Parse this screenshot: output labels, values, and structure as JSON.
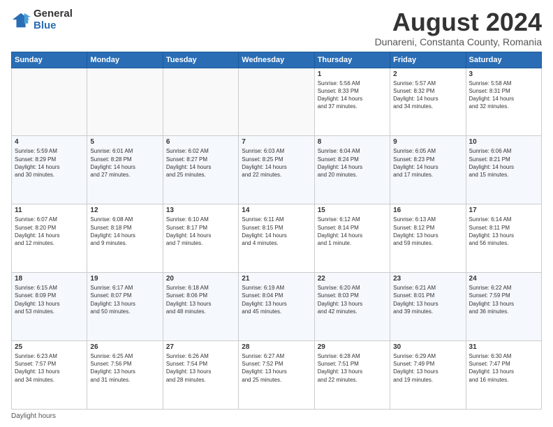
{
  "logo": {
    "general": "General",
    "blue": "Blue"
  },
  "title": "August 2024",
  "subtitle": "Dunareni, Constanta County, Romania",
  "days_header": [
    "Sunday",
    "Monday",
    "Tuesday",
    "Wednesday",
    "Thursday",
    "Friday",
    "Saturday"
  ],
  "footer": "Daylight hours",
  "weeks": [
    [
      {
        "day": "",
        "info": ""
      },
      {
        "day": "",
        "info": ""
      },
      {
        "day": "",
        "info": ""
      },
      {
        "day": "",
        "info": ""
      },
      {
        "day": "1",
        "info": "Sunrise: 5:56 AM\nSunset: 8:33 PM\nDaylight: 14 hours\nand 37 minutes."
      },
      {
        "day": "2",
        "info": "Sunrise: 5:57 AM\nSunset: 8:32 PM\nDaylight: 14 hours\nand 34 minutes."
      },
      {
        "day": "3",
        "info": "Sunrise: 5:58 AM\nSunset: 8:31 PM\nDaylight: 14 hours\nand 32 minutes."
      }
    ],
    [
      {
        "day": "4",
        "info": "Sunrise: 5:59 AM\nSunset: 8:29 PM\nDaylight: 14 hours\nand 30 minutes."
      },
      {
        "day": "5",
        "info": "Sunrise: 6:01 AM\nSunset: 8:28 PM\nDaylight: 14 hours\nand 27 minutes."
      },
      {
        "day": "6",
        "info": "Sunrise: 6:02 AM\nSunset: 8:27 PM\nDaylight: 14 hours\nand 25 minutes."
      },
      {
        "day": "7",
        "info": "Sunrise: 6:03 AM\nSunset: 8:25 PM\nDaylight: 14 hours\nand 22 minutes."
      },
      {
        "day": "8",
        "info": "Sunrise: 6:04 AM\nSunset: 8:24 PM\nDaylight: 14 hours\nand 20 minutes."
      },
      {
        "day": "9",
        "info": "Sunrise: 6:05 AM\nSunset: 8:23 PM\nDaylight: 14 hours\nand 17 minutes."
      },
      {
        "day": "10",
        "info": "Sunrise: 6:06 AM\nSunset: 8:21 PM\nDaylight: 14 hours\nand 15 minutes."
      }
    ],
    [
      {
        "day": "11",
        "info": "Sunrise: 6:07 AM\nSunset: 8:20 PM\nDaylight: 14 hours\nand 12 minutes."
      },
      {
        "day": "12",
        "info": "Sunrise: 6:08 AM\nSunset: 8:18 PM\nDaylight: 14 hours\nand 9 minutes."
      },
      {
        "day": "13",
        "info": "Sunrise: 6:10 AM\nSunset: 8:17 PM\nDaylight: 14 hours\nand 7 minutes."
      },
      {
        "day": "14",
        "info": "Sunrise: 6:11 AM\nSunset: 8:15 PM\nDaylight: 14 hours\nand 4 minutes."
      },
      {
        "day": "15",
        "info": "Sunrise: 6:12 AM\nSunset: 8:14 PM\nDaylight: 14 hours\nand 1 minute."
      },
      {
        "day": "16",
        "info": "Sunrise: 6:13 AM\nSunset: 8:12 PM\nDaylight: 13 hours\nand 59 minutes."
      },
      {
        "day": "17",
        "info": "Sunrise: 6:14 AM\nSunset: 8:11 PM\nDaylight: 13 hours\nand 56 minutes."
      }
    ],
    [
      {
        "day": "18",
        "info": "Sunrise: 6:15 AM\nSunset: 8:09 PM\nDaylight: 13 hours\nand 53 minutes."
      },
      {
        "day": "19",
        "info": "Sunrise: 6:17 AM\nSunset: 8:07 PM\nDaylight: 13 hours\nand 50 minutes."
      },
      {
        "day": "20",
        "info": "Sunrise: 6:18 AM\nSunset: 8:06 PM\nDaylight: 13 hours\nand 48 minutes."
      },
      {
        "day": "21",
        "info": "Sunrise: 6:19 AM\nSunset: 8:04 PM\nDaylight: 13 hours\nand 45 minutes."
      },
      {
        "day": "22",
        "info": "Sunrise: 6:20 AM\nSunset: 8:03 PM\nDaylight: 13 hours\nand 42 minutes."
      },
      {
        "day": "23",
        "info": "Sunrise: 6:21 AM\nSunset: 8:01 PM\nDaylight: 13 hours\nand 39 minutes."
      },
      {
        "day": "24",
        "info": "Sunrise: 6:22 AM\nSunset: 7:59 PM\nDaylight: 13 hours\nand 36 minutes."
      }
    ],
    [
      {
        "day": "25",
        "info": "Sunrise: 6:23 AM\nSunset: 7:57 PM\nDaylight: 13 hours\nand 34 minutes."
      },
      {
        "day": "26",
        "info": "Sunrise: 6:25 AM\nSunset: 7:56 PM\nDaylight: 13 hours\nand 31 minutes."
      },
      {
        "day": "27",
        "info": "Sunrise: 6:26 AM\nSunset: 7:54 PM\nDaylight: 13 hours\nand 28 minutes."
      },
      {
        "day": "28",
        "info": "Sunrise: 6:27 AM\nSunset: 7:52 PM\nDaylight: 13 hours\nand 25 minutes."
      },
      {
        "day": "29",
        "info": "Sunrise: 6:28 AM\nSunset: 7:51 PM\nDaylight: 13 hours\nand 22 minutes."
      },
      {
        "day": "30",
        "info": "Sunrise: 6:29 AM\nSunset: 7:49 PM\nDaylight: 13 hours\nand 19 minutes."
      },
      {
        "day": "31",
        "info": "Sunrise: 6:30 AM\nSunset: 7:47 PM\nDaylight: 13 hours\nand 16 minutes."
      }
    ]
  ]
}
